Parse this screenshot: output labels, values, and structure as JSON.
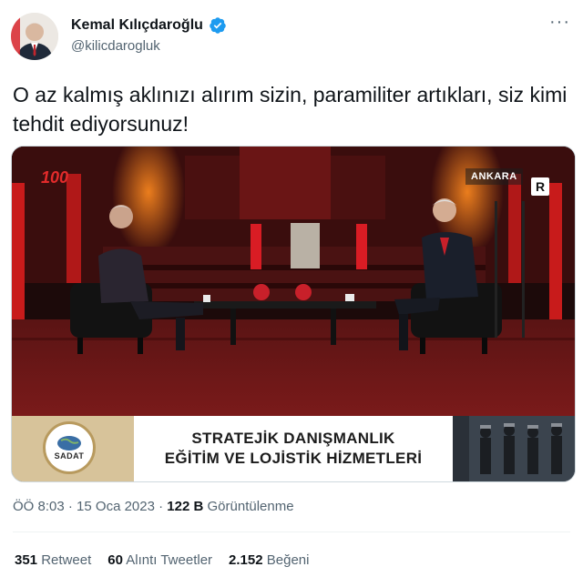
{
  "author": {
    "name": "Kemal Kılıçdaroğlu",
    "handle": "@kilicdarogluk",
    "verified_icon": "verified-badge-icon",
    "verified_color": "#1d9bf0"
  },
  "more_icon": "more-options-icon",
  "tweet": {
    "text": "O az kalmış aklınızı alırım sizin, paramiliter artıkları, siz kimi tehdit ediyorsunuz!"
  },
  "media": {
    "channel_logo": "100",
    "location_tag": "ANKARA",
    "corner_logo": "R",
    "banner": {
      "logo_text": "SADAT",
      "line1": "STRATEJİK DANIŞMANLIK",
      "line2": "EĞİTİM VE LOJİSTİK HİZMETLERİ"
    }
  },
  "meta": {
    "time": "ÖÖ 8:03",
    "separator": "·",
    "date": "15 Oca 2023",
    "views_count": "122 B",
    "views_label": "Görüntülenme"
  },
  "stats": {
    "retweets_count": "351",
    "retweets_label": "Retweet",
    "quotes_count": "60",
    "quotes_label": "Alıntı Tweetler",
    "likes_count": "2.152",
    "likes_label": "Beğeni"
  }
}
